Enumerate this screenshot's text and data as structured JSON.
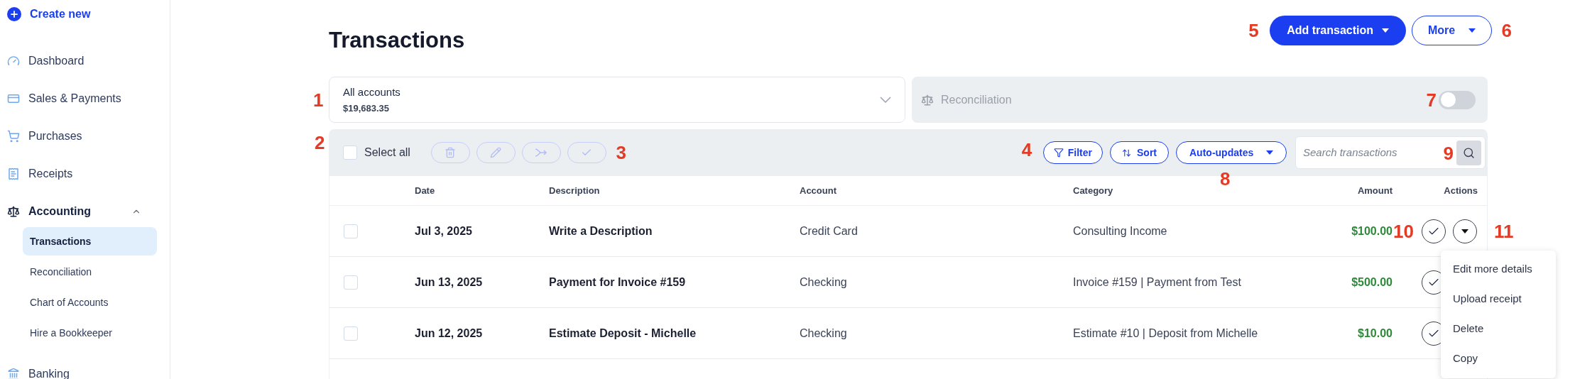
{
  "sidebar": {
    "create_button": "Create new",
    "items": [
      {
        "label": "Dashboard",
        "selected": false
      },
      {
        "label": "Sales & Payments",
        "selected": false
      },
      {
        "label": "Purchases",
        "selected": false
      },
      {
        "label": "Receipts",
        "selected": false
      },
      {
        "label": "Accounting",
        "selected": true,
        "expanded": true,
        "children": [
          {
            "label": "Transactions",
            "selected": true
          },
          {
            "label": "Reconciliation",
            "selected": false
          },
          {
            "label": "Chart of Accounts",
            "selected": false
          },
          {
            "label": "Hire a Bookkeeper",
            "selected": false
          }
        ]
      },
      {
        "label": "Banking",
        "selected": false
      }
    ]
  },
  "page_title": "Transactions",
  "add_button": {
    "label": "Add transaction",
    "callout": "5"
  },
  "more_button": {
    "label": "More",
    "callout": "6"
  },
  "account_selector": {
    "label": "All accounts",
    "balance": "$19,683.35",
    "callout": "1"
  },
  "reconciliation": {
    "label": "Reconciliation",
    "on": false,
    "callout": "7"
  },
  "toolbar": {
    "select_all": {
      "label": "Select all",
      "checked": false,
      "callout": "2"
    },
    "bulk_actions": [
      {
        "disabled": true
      },
      {
        "disabled": true
      },
      {
        "disabled": true
      },
      {
        "disabled": true
      }
    ],
    "bulk_callout": "3",
    "filter": "Filter",
    "sort": "Sort",
    "filter_callout": "4",
    "auto_updates": {
      "label": "Auto-updates",
      "callout": "8"
    },
    "search": {
      "placeholder": "Search transactions",
      "callout": "9"
    }
  },
  "table": {
    "columns": [
      "Date",
      "Description",
      "Account",
      "Category",
      "Amount",
      "Actions"
    ],
    "rows": [
      {
        "checked": false,
        "date": "Jul 3, 2025",
        "description": "Write a Description",
        "account": "Credit Card",
        "category": "Consulting Income",
        "amount": "$100.00",
        "check_callout": "10",
        "menu_callout": "11",
        "menu": [
          "Edit more details",
          "Upload receipt",
          "Delete",
          "Copy"
        ]
      },
      {
        "checked": false,
        "date": "Jun 13, 2025",
        "description": "Payment for Invoice #159",
        "account": "Checking",
        "category": "Invoice #159 | Payment from Test",
        "amount": "$500.00"
      },
      {
        "checked": false,
        "date": "Jun 12, 2025",
        "description": "Estimate Deposit - Michelle",
        "account": "Checking",
        "category": "Estimate #10 | Deposit from Michelle",
        "amount": "$10.00"
      }
    ]
  }
}
